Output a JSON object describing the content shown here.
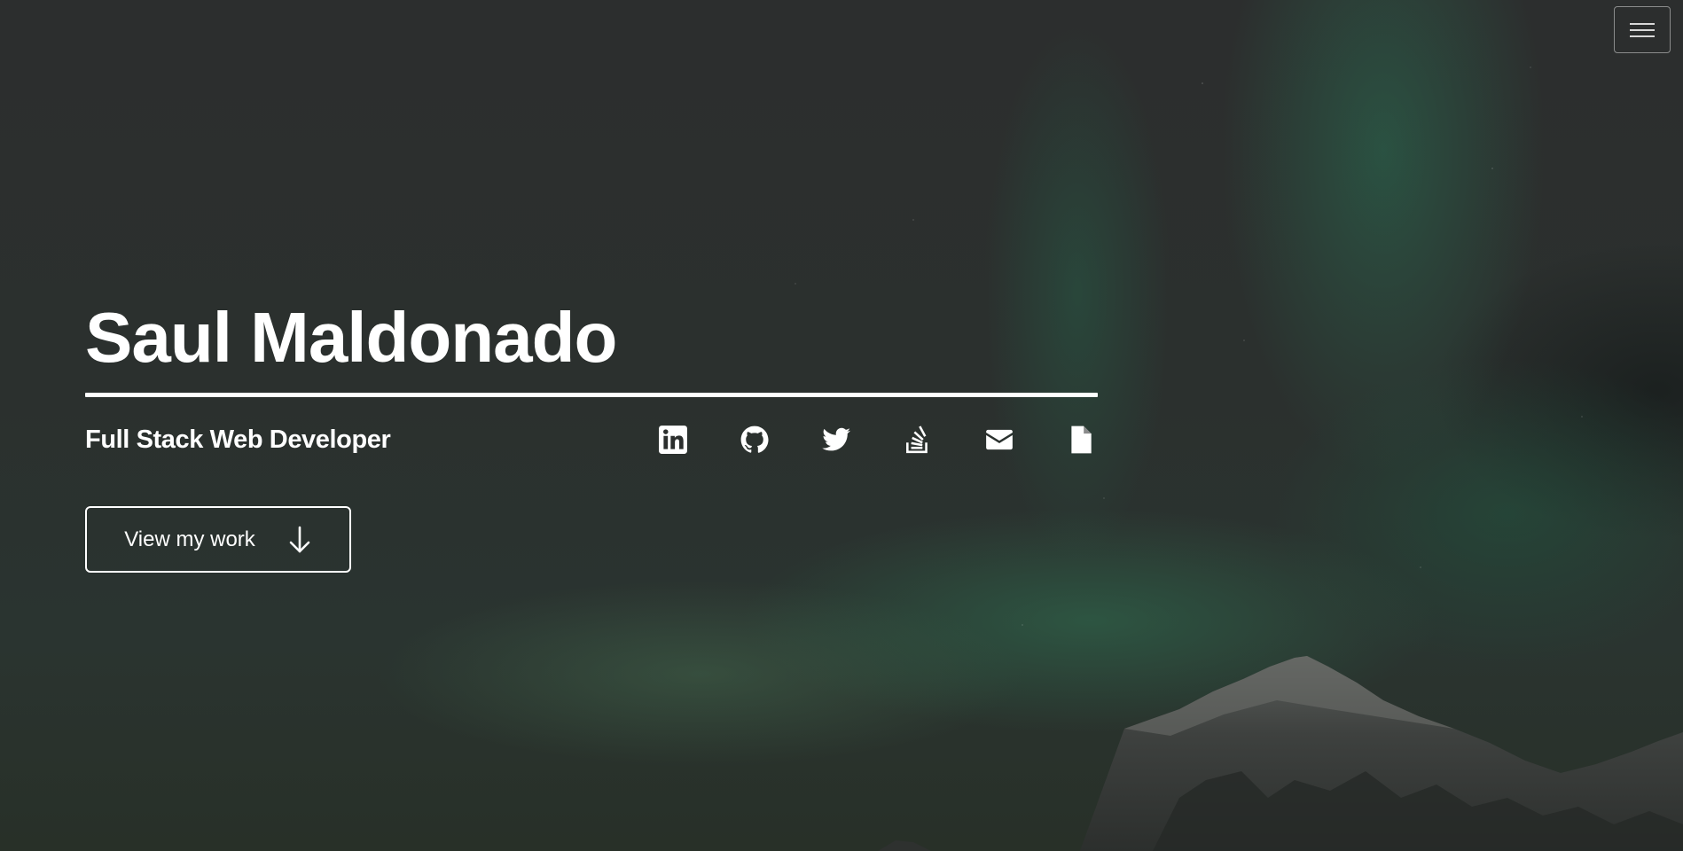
{
  "hero": {
    "name": "Saul Maldonado",
    "tagline": "Full Stack Web Developer",
    "cta_label": "View my work"
  },
  "header": {
    "menu_icon": "hamburger-menu-icon"
  },
  "socials": [
    {
      "icon": "linkedin-icon"
    },
    {
      "icon": "github-icon"
    },
    {
      "icon": "twitter-icon"
    },
    {
      "icon": "stackoverflow-icon"
    },
    {
      "icon": "envelope-icon"
    },
    {
      "icon": "document-icon"
    }
  ],
  "colors": {
    "text": "#ffffff",
    "background": "#2a2c2b",
    "aurora": "#2a6e52"
  }
}
